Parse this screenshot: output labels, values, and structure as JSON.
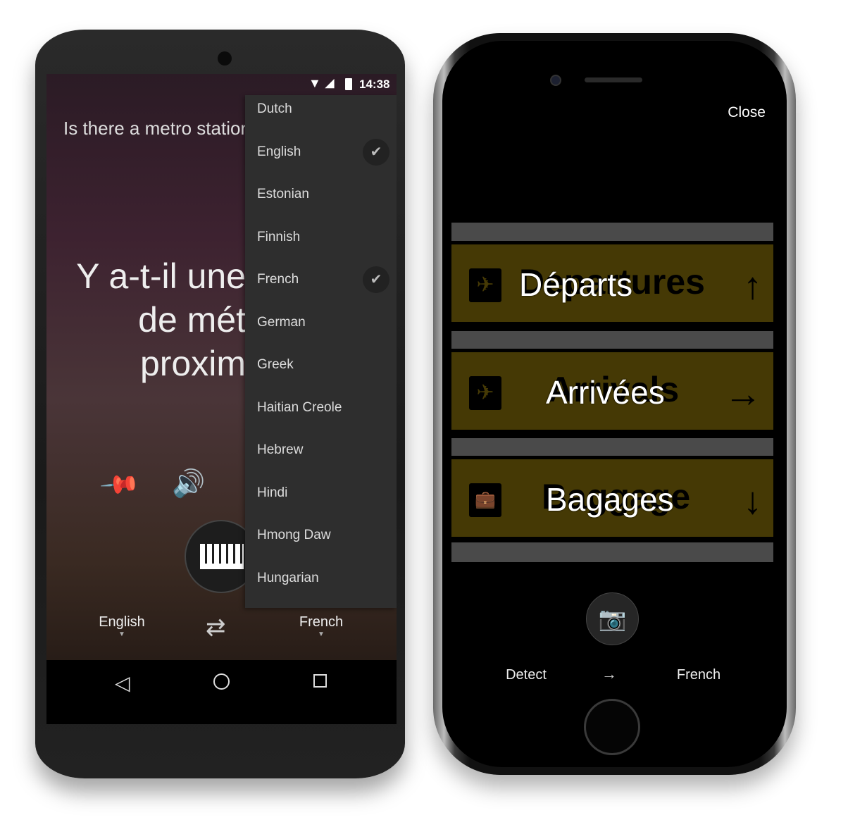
{
  "android": {
    "status": {
      "time": "14:38"
    },
    "source_text": "Is there a metro station",
    "translation_lines": [
      "Y a-t-il une",
      "de mét",
      "proxim"
    ],
    "menu": {
      "items": [
        {
          "label": "Dutch",
          "checked": false
        },
        {
          "label": "English",
          "checked": true
        },
        {
          "label": "Estonian",
          "checked": false
        },
        {
          "label": "Finnish",
          "checked": false
        },
        {
          "label": "French",
          "checked": true
        },
        {
          "label": "German",
          "checked": false
        },
        {
          "label": "Greek",
          "checked": false
        },
        {
          "label": "Haitian Creole",
          "checked": false
        },
        {
          "label": "Hebrew",
          "checked": false
        },
        {
          "label": "Hindi",
          "checked": false
        },
        {
          "label": "Hmong Daw",
          "checked": false
        },
        {
          "label": "Hungarian",
          "checked": false
        }
      ]
    },
    "from_language": "English",
    "to_language": "French"
  },
  "iphone": {
    "close_label": "Close",
    "signs": [
      {
        "original": "Departures",
        "translation": "Départs",
        "icon": "airplane-icon",
        "arrow": "↑"
      },
      {
        "original": "Arrivals",
        "translation": "Arrivées",
        "icon": "airplane-icon",
        "arrow": "→"
      },
      {
        "original": "Baggage",
        "translation": "Bagages",
        "icon": "suitcase-icon",
        "arrow": "↓"
      }
    ],
    "from_language": "Detect",
    "arrow": "→",
    "to_language": "French"
  },
  "colors": {
    "sign_band": "#453905",
    "menu_bg": "#2e2e2e"
  }
}
